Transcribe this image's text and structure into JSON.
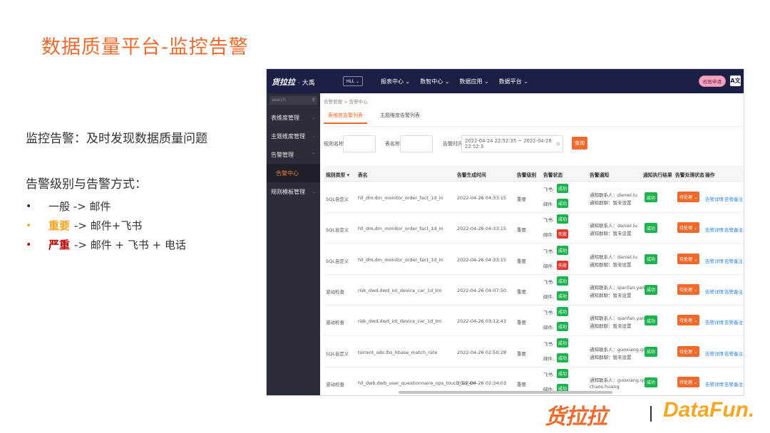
{
  "slide": {
    "title": "数据质量平台-监控告警",
    "intro": "监控告警：及时发现数据质量问题",
    "level_heading": "告警级别与告警方式：",
    "levels": [
      {
        "bullet": "•",
        "keyword": "",
        "rest": "一般 -> 邮件",
        "color": "#333333"
      },
      {
        "bullet": "•",
        "keyword": "重要",
        "rest": "-> 邮件+飞书",
        "color": "#f5a623"
      },
      {
        "bullet": "•",
        "keyword": "严重",
        "rest": "-> 邮件 + 飞书 + 电话",
        "color": "#c00000"
      }
    ]
  },
  "app": {
    "logo": "货拉拉",
    "logo_sub": "· 大禹",
    "env": "HLL ⌄",
    "nav": [
      "报表中心 ⌄",
      "数智中心 ⌄",
      "数据应用 ⌄",
      "数据平台 ⌄"
    ],
    "perm_button": "权限申请",
    "lang_icon": "A文",
    "sidebar": {
      "search_placeholder": "search",
      "items": [
        "表维度管理",
        "主题维度管理",
        "告警管理",
        "告警中心",
        "规则模板管理"
      ]
    },
    "breadcrumb": "告警管理 > 告警中心",
    "tabs": [
      "表维度告警列表",
      "主题维度告警列表"
    ],
    "filters": {
      "rule_label": "规则名称",
      "table_label": "表名称",
      "time_label": "告警时间",
      "time_value": "2022-04-24 22:52:35 ~ 2022-04-26 22:52:3",
      "query_button": "查询"
    },
    "columns": [
      "规则类型",
      "表名",
      "告警生成时间",
      "告警级别",
      "告警状态",
      "告警通知",
      "通知执行结果",
      "告警处理状态",
      "操作"
    ],
    "status_labels": {
      "feishu": "飞书:",
      "mail": "邮件:"
    },
    "ops": [
      "告警详情",
      "告警备注"
    ],
    "rows": [
      {
        "type": "SQL自定义",
        "table": "hll_dm.dm_monitor_order_fact_1d_in",
        "time": "2022-04-26 04:33:15",
        "level": "重要",
        "feishu": "成功",
        "feishu_ok": true,
        "mail": "成功",
        "mail_ok": true,
        "notify1": "通知联系人：daniel.lu",
        "notify2": "通知群聊：暂未设置",
        "exec": "成功",
        "handle": "待处理 ⌄"
      },
      {
        "type": "SQL自定义",
        "table": "hll_dm.dm_monitor_order_fact_1d_in",
        "time": "2022-04-26 04:33:15",
        "level": "重要",
        "feishu": "成功",
        "feishu_ok": true,
        "mail": "失败",
        "mail_ok": false,
        "notify1": "通知联系人：daniel.lu",
        "notify2": "通知群聊：暂未设置",
        "exec": "成功",
        "handle": "待处理 ⌄"
      },
      {
        "type": "SQL自定义",
        "table": "hll_dm.dm_monitor_order_fact_1d_in",
        "time": "2022-04-26 04:33:15",
        "level": "重要",
        "feishu": "成功",
        "feishu_ok": true,
        "mail": "失败",
        "mail_ok": false,
        "notify1": "通知联系人：daniel.lu",
        "notify2": "通知群聊：暂未设置",
        "exec": "成功",
        "handle": "待处理 ⌄"
      },
      {
        "type": "波动检查",
        "table": "risk_dwd.dwd_iot_device_car_1d_tm",
        "time": "2022-04-26 04:07:50",
        "level": "重要",
        "feishu": "成功",
        "feishu_ok": true,
        "mail": "成功",
        "mail_ok": true,
        "notify1": "通知联系人：qianfan.yang",
        "notify2": "通知群聊：暂未设置",
        "exec": "成功",
        "handle": "待处理 ⌄"
      },
      {
        "type": "波动检查",
        "table": "risk_dwd.dwd_iot_device_car_1d_tm",
        "time": "2022-04-26 03:12:43",
        "level": "重要",
        "feishu": "成功",
        "feishu_ok": true,
        "mail": "成功",
        "mail_ok": true,
        "notify1": "通知联系人：qianfan.yang",
        "notify2": "通知群聊：暂未设置",
        "exec": "成功",
        "handle": "待处理 ⌄"
      },
      {
        "type": "SQL自定义",
        "table": "torrent_ods.lbs_hbase_match_rate",
        "time": "2022-04-26 02:50:28",
        "level": "重要",
        "feishu": "成功",
        "feishu_ok": true,
        "mail": "成功",
        "mail_ok": true,
        "notify1": "通知联系人：guoxiang.qi",
        "notify2": "通知群聊：暂未设置",
        "exec": "成功",
        "handle": "待处理 ⌄"
      },
      {
        "type": "波动检查",
        "table": "hll_dwb.dwb_user_questionnaire_nps_touch_1d_tm",
        "time": "2022-04-26 02:34:03",
        "level": "重要",
        "feishu": "成功",
        "feishu_ok": true,
        "mail": "成功",
        "mail_ok": true,
        "notify1": "通知联系人：guoxiang.qi,",
        "notify2": "chaos.huang",
        "exec": "成功",
        "handle": "待处理 ⌄"
      }
    ]
  },
  "footer": {
    "brand": "货拉拉",
    "partner": "DataFun."
  }
}
